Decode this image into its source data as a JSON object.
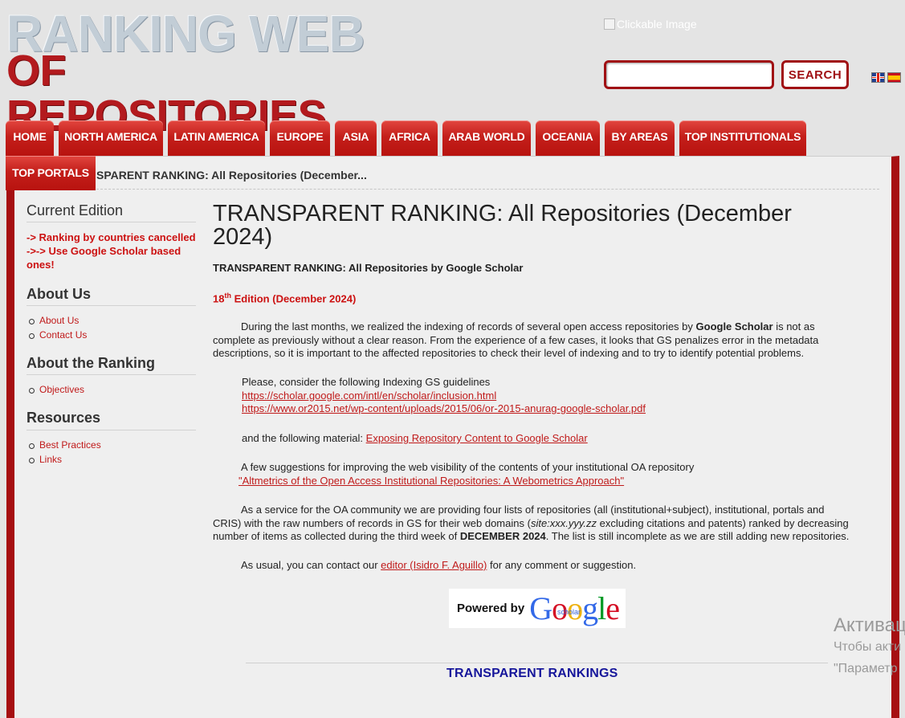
{
  "header": {
    "logo_line1": "RANKING WEB",
    "logo_line2": "OF REPOSITORIES",
    "clickable_image_alt": "Clickable Image",
    "search_value": "",
    "search_button": "SEARCH",
    "languages": [
      "english-flag",
      "spanish-flag"
    ]
  },
  "nav": {
    "tabs": [
      "HOME",
      "NORTH AMERICA",
      "LATIN AMERICA",
      "EUROPE",
      "ASIA",
      "AFRICA",
      "ARAB WORLD",
      "OCEANIA",
      "BY AREAS",
      "TOP INSTITUTIONALS"
    ],
    "tab2": "TOP PORTALS"
  },
  "breadcrumb": "SPARENT RANKING: All Repositories (December...",
  "sidebar": {
    "current_edition": {
      "title": "Current Edition",
      "note1": "-> Ranking by countries cancelled",
      "note2": "->-> Use Google Scholar based ones!"
    },
    "about_us": {
      "title": "About Us",
      "items": [
        "About Us",
        "Contact Us"
      ]
    },
    "about_ranking": {
      "title": "About the Ranking",
      "items": [
        "Objectives"
      ]
    },
    "resources": {
      "title": "Resources",
      "items": [
        "Best Practices",
        "Links"
      ]
    }
  },
  "main": {
    "title": "TRANSPARENT RANKING: All Repositories (December 2024)",
    "subtitle": "TRANSPARENT RANKING: All Repositories by Google Scholar",
    "edition_num": "18",
    "edition_sup": "th",
    "edition_rest": " Edition (December 2024)",
    "para1_a": "During the last months, we realized the indexing of records of several open access repositories by ",
    "para1_b": "Google Scholar",
    "para1_c": " is not as complete as previously without a clear reason. From the experience of a few cases, it looks that GS penalizes error in the metadata descriptions, so it is important to the affected repositories to check their level of indexing and to try to identify potential problems.",
    "guidelines_intro": "Please, consider the following Indexing GS guidelines",
    "link1": "https://scholar.google.com/intl/en/scholar/inclusion.html",
    "link2": "https://www.or2015.net/wp-content/uploads/2015/06/or-2015-anurag-google-scholar.pdf",
    "material_intro": "and the following material: ",
    "material_link": "Exposing Repository Content to Google Scholar",
    "suggestions_intro": "A few suggestions for improving the web visibility of the contents of your institutional OA repository",
    "suggestions_link": "\"Altmetrics of the Open Access Institutional Repositories: A Webometrics Approach\"",
    "para4_a": "As a service for the OA community we are providing four lists of repositories (all (institutional+subject), institutional, portals and CRIS) with the raw numbers of records in GS for their web domains (",
    "para4_b": "site:xxx.yyy.zz",
    "para4_c": " excluding citations and patents) ranked by decreasing number of items as collected during the third week of ",
    "para4_d": "DECEMBER 2024",
    "para4_e": ". The list is still incomplete as we are still adding new repositories.",
    "contact_a": "As usual, you can contact our ",
    "contact_link": "editor (Isidro F. Aguillo)",
    "contact_b": " for any comment or suggestion.",
    "powered_by": "Powered by",
    "google_letters": [
      "G",
      "o",
      "o",
      "g",
      "l",
      "e"
    ],
    "google_colors": [
      "#3369e8",
      "#d50f25",
      "#eeb211",
      "#3369e8",
      "#009925",
      "#d50f25"
    ],
    "scholar": "scholar",
    "transparent_rankings": "TRANSPARENT RANKINGS"
  },
  "overlay": {
    "line1": "Активац",
    "line2": "Чтобы акти",
    "line3": "\"Параметр"
  }
}
